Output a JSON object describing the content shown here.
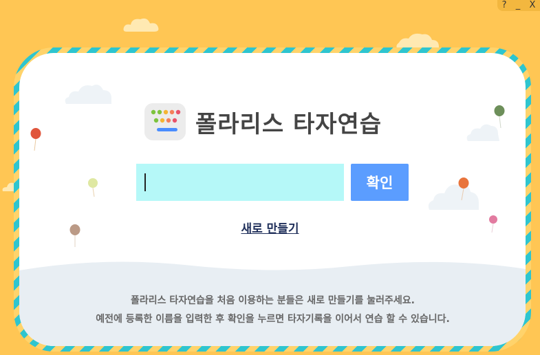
{
  "window": {
    "help_label": "?",
    "minimize_label": "_",
    "close_label": "X"
  },
  "app": {
    "title": "폴라리스 타자연습"
  },
  "login": {
    "input_value": "",
    "confirm_label": "확인",
    "new_label": "새로 만들기"
  },
  "info": {
    "line1": "폴라리스 타자연습을 처음 이용하는 분들은 새로 만들기를 눌러주세요.",
    "line2": "예전에 등록한 이름을 입력한 후 확인을 누르면 타자기록을 이어서 연습 할 수 있습니다."
  },
  "colors": {
    "background": "#ffc654",
    "border_stripe_a": "#2ec5cf",
    "border_stripe_b": "#ffd36b",
    "input_bg": "#b5f8f8",
    "button_bg": "#5b9dff"
  }
}
